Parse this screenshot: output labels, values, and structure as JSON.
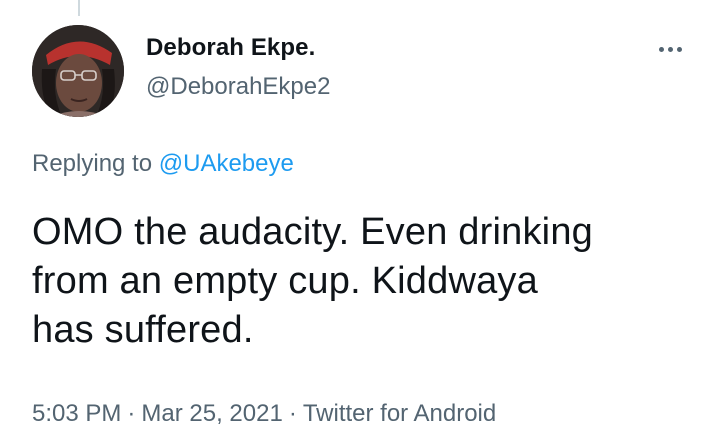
{
  "user": {
    "display_name": "Deborah Ekpe.",
    "handle": "@DeborahEkpe2",
    "avatar": "profile-photo"
  },
  "icons": {
    "more": "more-horizontal-icon"
  },
  "reply": {
    "prefix": "Replying to",
    "mention": "@UAkebeye"
  },
  "tweet": {
    "lines": [
      "OMO the audacity. Even drinking",
      "from an empty cup. Kiddwaya",
      "has suffered."
    ]
  },
  "meta": {
    "time": "5:03 PM",
    "separator": "·",
    "date": "Mar 25, 2021",
    "source": "Twitter for Android"
  },
  "colors": {
    "text": "#0f1419",
    "secondary": "#536471",
    "link": "#1d9bf0"
  }
}
